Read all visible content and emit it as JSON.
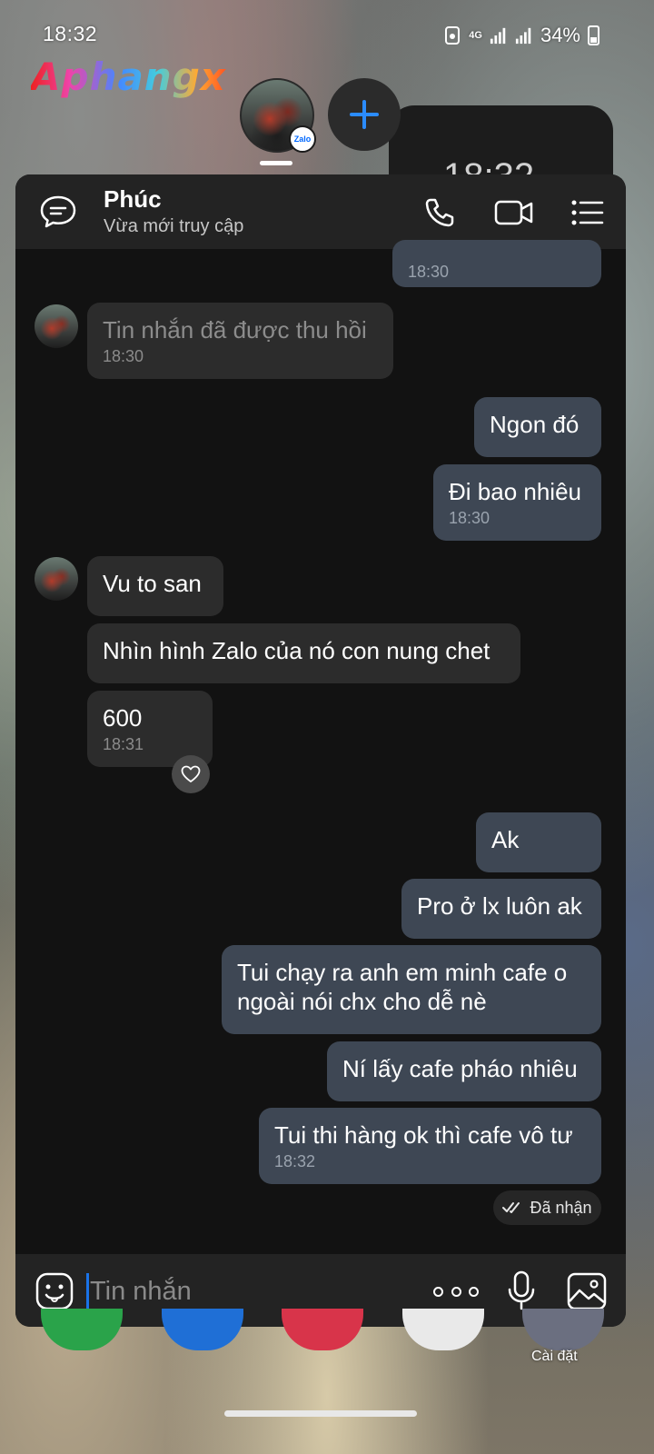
{
  "status_bar": {
    "time": "18:32",
    "network": "4G",
    "battery_percent": "34%",
    "battery_level": 0.34
  },
  "watermark": {
    "text": "Aphangx"
  },
  "bubble_switcher": {
    "badge_text": "Zalo",
    "clock_widget_text": "18:32"
  },
  "chat": {
    "contact_name": "Phúc",
    "contact_status": "Vừa mới truy cập",
    "messages": [
      {
        "direction": "out",
        "text": "",
        "time": "18:30"
      },
      {
        "direction": "in",
        "text": "Tin nhắn đã được thu hồi",
        "time": "18:30",
        "recalled": true
      },
      {
        "direction": "out",
        "text": "Ngon đó",
        "time": ""
      },
      {
        "direction": "out",
        "text": "Đi bao nhiêu",
        "time": "18:30"
      },
      {
        "direction": "in",
        "text": "Vu to san",
        "time": ""
      },
      {
        "direction": "in",
        "text": "Nhìn hình Zalo của nó con nung chet",
        "time": ""
      },
      {
        "direction": "in",
        "text": "600",
        "time": "18:31"
      },
      {
        "direction": "out",
        "text": "Ak",
        "time": ""
      },
      {
        "direction": "out",
        "text": "Pro ở lx luôn ak",
        "time": ""
      },
      {
        "direction": "out",
        "text": "Tui chạy ra anh em minh cafe o ngoài nói chx cho dễ nè",
        "line1": "Tui chạy ra anh em minh cafe o",
        "line2": "ngoài nói chx cho dễ nè",
        "time": ""
      },
      {
        "direction": "out",
        "text": "Ní lấy cafe pháo nhiêu",
        "time": ""
      },
      {
        "direction": "out",
        "text": "Tui thi hàng ok thì cafe vô tư",
        "time": "18:32"
      }
    ],
    "delivery_status": "Đã nhận"
  },
  "input": {
    "placeholder": "Tin nhắn"
  },
  "dock": {
    "settings_label": "Cài đặt"
  },
  "colors": {
    "chat_background": "#121212",
    "header_background": "#232323",
    "incoming_bubble": "#2c2c2c",
    "outgoing_bubble": "#3e4754",
    "accent": "#1a73e8"
  },
  "icons": [
    "chat-icon",
    "phone-icon",
    "video-icon",
    "menu-icon",
    "heart-icon",
    "double-check-icon",
    "emoji-icon",
    "more-icon",
    "mic-icon",
    "image-icon",
    "plus-icon"
  ]
}
